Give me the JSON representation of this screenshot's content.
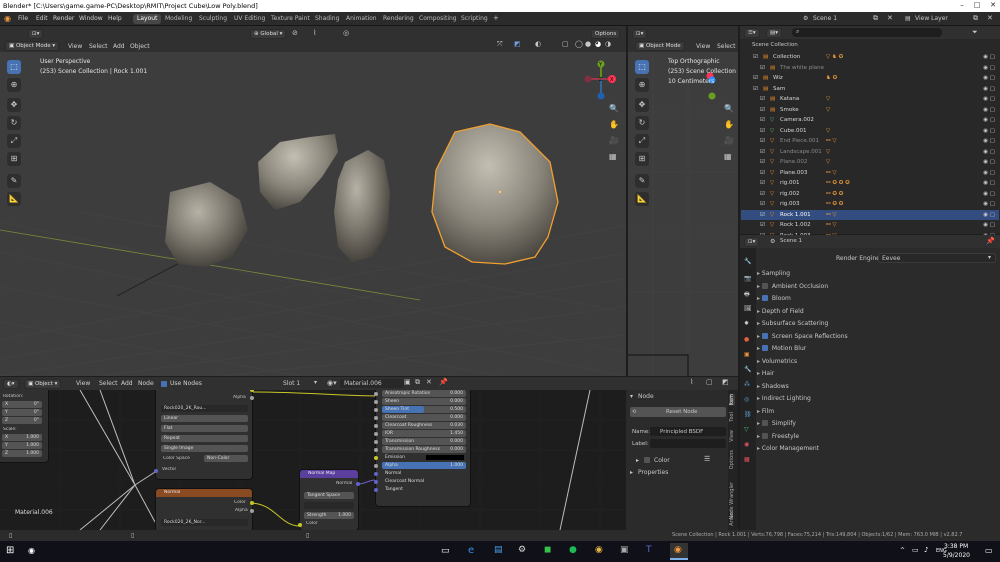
{
  "window": {
    "title": "Blender* [C:\\Users\\game.game-PC\\Desktop\\RMIT\\Project Cube\\Low Poly.blend]"
  },
  "menu": [
    "File",
    "Edit",
    "Render",
    "Window",
    "Help"
  ],
  "workspaces": [
    "Layout",
    "Modeling",
    "Sculpting",
    "UV Editing",
    "Texture Paint",
    "Shading",
    "Animation",
    "Rendering",
    "Compositing",
    "Scripting"
  ],
  "top_right": {
    "scene": "Scene 1",
    "view_layer": "View Layer"
  },
  "viewport": {
    "mode": "Object Mode",
    "menus": [
      "View",
      "Select",
      "Add",
      "Object"
    ],
    "orientation": "Global",
    "options": "Options",
    "overlay_title": "User Perspective",
    "overlay_sub": "(253) Scene Collection | Rock 1.001"
  },
  "viewport2": {
    "mode": "Object Mode",
    "menus": [
      "View",
      "Select"
    ],
    "overlay_title": "Top Orthographic",
    "overlay_sub": "(253) Scene Collection | Ro",
    "overlay_units": "10 Centimeters"
  },
  "outliner": {
    "title": "Scene Collection",
    "rows": [
      {
        "label": "Collection"
      },
      {
        "label": "The white plane"
      },
      {
        "label": "Wiz"
      },
      {
        "label": "Sam"
      },
      {
        "label": "Katana"
      },
      {
        "label": "Smoke"
      },
      {
        "label": "Camera.002"
      },
      {
        "label": "Cube.001"
      },
      {
        "label": "End Piece.001"
      },
      {
        "label": "Landscape.001"
      },
      {
        "label": "Plane.002"
      },
      {
        "label": "Plane.003"
      },
      {
        "label": "rig.001"
      },
      {
        "label": "rig.002"
      },
      {
        "label": "rig.003"
      },
      {
        "label": "Rock 1.001"
      },
      {
        "label": "Rock 1.002"
      },
      {
        "label": "Rock 1.003"
      }
    ]
  },
  "properties": {
    "scene": "Scene 1",
    "render_engine_label": "Render Engine",
    "render_engine": "Eevee",
    "panels": [
      {
        "label": "Sampling"
      },
      {
        "label": "Ambient Occlusion"
      },
      {
        "label": "Bloom"
      },
      {
        "label": "Depth of Field"
      },
      {
        "label": "Subsurface Scattering"
      },
      {
        "label": "Screen Space Reflections"
      },
      {
        "label": "Motion Blur"
      },
      {
        "label": "Volumetrics"
      },
      {
        "label": "Hair"
      },
      {
        "label": "Shadows"
      },
      {
        "label": "Indirect Lighting"
      },
      {
        "label": "Film"
      },
      {
        "label": "Simplify"
      },
      {
        "label": "Freestyle"
      },
      {
        "label": "Color Management"
      }
    ]
  },
  "node_editor": {
    "editor_type": "Object",
    "menus": [
      "View",
      "Select",
      "Add",
      "Node"
    ],
    "use_nodes": "Use Nodes",
    "slot": "Slot 1",
    "material": "Material.006",
    "material_label": "Material.006",
    "left_panel": {
      "rotation": "Rotation:",
      "scale": "Scale:",
      "rot": [
        {
          "axis": "X",
          "val": "0°"
        },
        {
          "axis": "Y",
          "val": "0°"
        },
        {
          "axis": "Z",
          "val": "0°"
        }
      ],
      "scl": [
        {
          "axis": "X",
          "val": "1.000"
        },
        {
          "axis": "Y",
          "val": "1.000"
        },
        {
          "axis": "Z",
          "val": "1.000"
        }
      ]
    },
    "tex1": {
      "out_color": "Color",
      "out_alpha": "Alpha",
      "image": "Rock020_2K_Rou...",
      "interp": "Linear",
      "proj": "Flat",
      "ext": "Repeat",
      "source": "Single Image",
      "cs_label": "Color Space",
      "cs_value": "Non-Color",
      "vector": "Vector"
    },
    "tex2": {
      "header": "Normal",
      "out_color": "Color",
      "out_alpha": "Alpha",
      "image": "Rock020_2K_Nor..."
    },
    "normal_map": {
      "header": "Normal Map",
      "out": "Normal",
      "space": "Tangent Space",
      "strength_label": "Strength",
      "strength": "1.000",
      "color": "Color"
    },
    "bsdf_rows": [
      {
        "label": "Anisotropic Rotation",
        "val": "0.000"
      },
      {
        "label": "Sheen",
        "val": "0.000"
      },
      {
        "label": "Sheen Tint",
        "val": "0.500"
      },
      {
        "label": "Clearcoat",
        "val": "0.000"
      },
      {
        "label": "Clearcoat Roughness",
        "val": "0.030"
      },
      {
        "label": "IOR",
        "val": "1.450"
      },
      {
        "label": "Transmission",
        "val": "0.000"
      },
      {
        "label": "Transmission Roughness",
        "val": "0.000"
      },
      {
        "label": "Emission",
        "val": ""
      },
      {
        "label": "Alpha",
        "val": "1.000"
      },
      {
        "label": "Normal",
        "val": ""
      },
      {
        "label": "Clearcoat Normal",
        "val": ""
      },
      {
        "label": "Tangent",
        "val": ""
      }
    ]
  },
  "node_sidebar": {
    "section": "Node",
    "reset": "Reset Node",
    "name_label": "Name:",
    "name": "Principled BSDF",
    "label_label": "Label:",
    "color": "Color",
    "properties": "Properties",
    "tabs": [
      "Item",
      "Tool",
      "View",
      "Options",
      "Node Wrangler",
      "Arran"
    ]
  },
  "status": "Scene Collection | Rock 1.001 | Verts:76,798 | Faces:75,214 | Tris:149,804 | Objects:1/62 | Mem: 763.0 MiB | v2.82.7",
  "taskbar": {
    "time": "3:38 PM",
    "date": "5/9/2020",
    "lang": "ENG"
  },
  "colors": {
    "accent": "#4772b3",
    "selected_outline": "#f0a030",
    "bg": "#1d1d1d"
  }
}
